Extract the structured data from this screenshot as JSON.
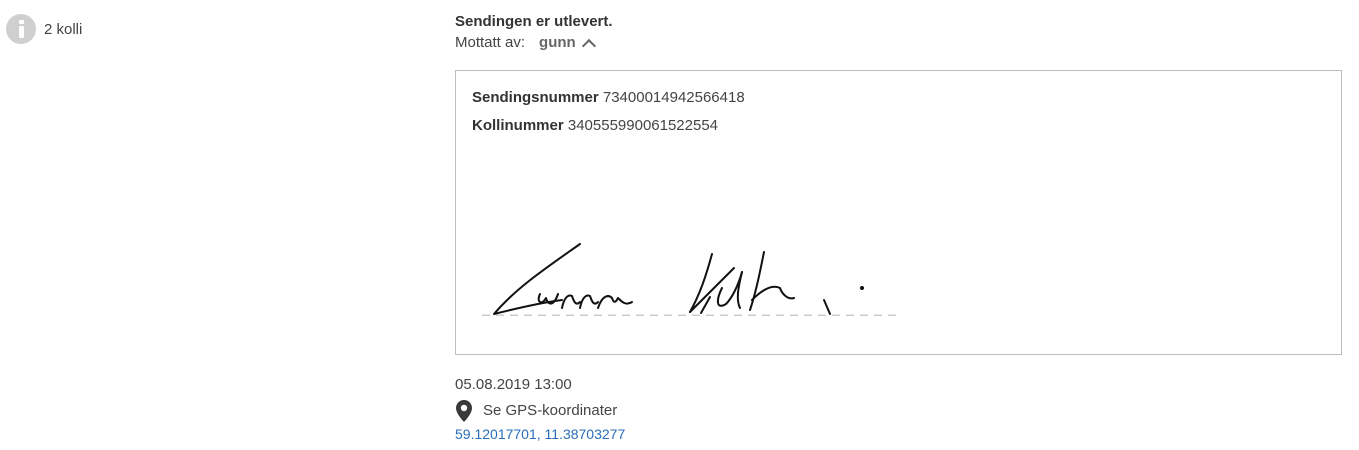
{
  "summary": {
    "icon": "info-icon",
    "colli_label": "2 kolli"
  },
  "delivery": {
    "status_title": "Sendingen er utlevert.",
    "received_by_label": "Mottatt av:",
    "received_by_name": "gunn",
    "toggle_icon": "chevron-up-icon"
  },
  "details": {
    "shipment_number_label": "Sendingsnummer",
    "shipment_number": "73400014942566418",
    "package_number_label": "Kollinummer",
    "package_number": "340555990061522554",
    "signature_caption": "Gunn Krb..."
  },
  "meta": {
    "timestamp": "05.08.2019 13:00",
    "gps_icon": "map-pin-icon",
    "gps_label": "Se GPS-koordinater",
    "coordinates": "59.12017701, 11.38703277"
  },
  "colors": {
    "text": "#333333",
    "muted_icon": "#cfcfcf",
    "link": "#2a6ebb",
    "box_border": "#bdbdbd",
    "signature_line": "#cccccc"
  }
}
